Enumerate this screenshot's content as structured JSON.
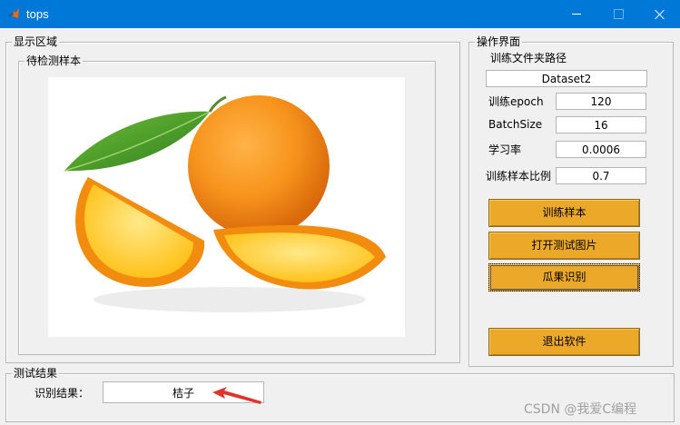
{
  "window": {
    "title": "tops"
  },
  "display_area": {
    "title": "显示区域",
    "sample_panel": {
      "title": "待检测样本"
    }
  },
  "ops": {
    "title": "操作界面",
    "folder_label": "训练文件夹路径",
    "folder_value": "Dataset2",
    "params": [
      {
        "label": "训练epoch",
        "value": "120"
      },
      {
        "label": "BatchSize",
        "value": "16"
      },
      {
        "label": "学习率",
        "value": "0.0006"
      },
      {
        "label": "训练样本比例",
        "value": "0.7"
      }
    ],
    "buttons": {
      "train": "训练样本",
      "open_test": "打开测试图片",
      "recognize": "瓜果识别",
      "exit": "退出软件"
    }
  },
  "result": {
    "title": "测试结果",
    "label": "识别结果：",
    "value": "桔子"
  },
  "watermark": "CSDN @我爱C编程",
  "icons": {
    "app": "matlab-icon",
    "pointer": "red-arrow-icon"
  }
}
